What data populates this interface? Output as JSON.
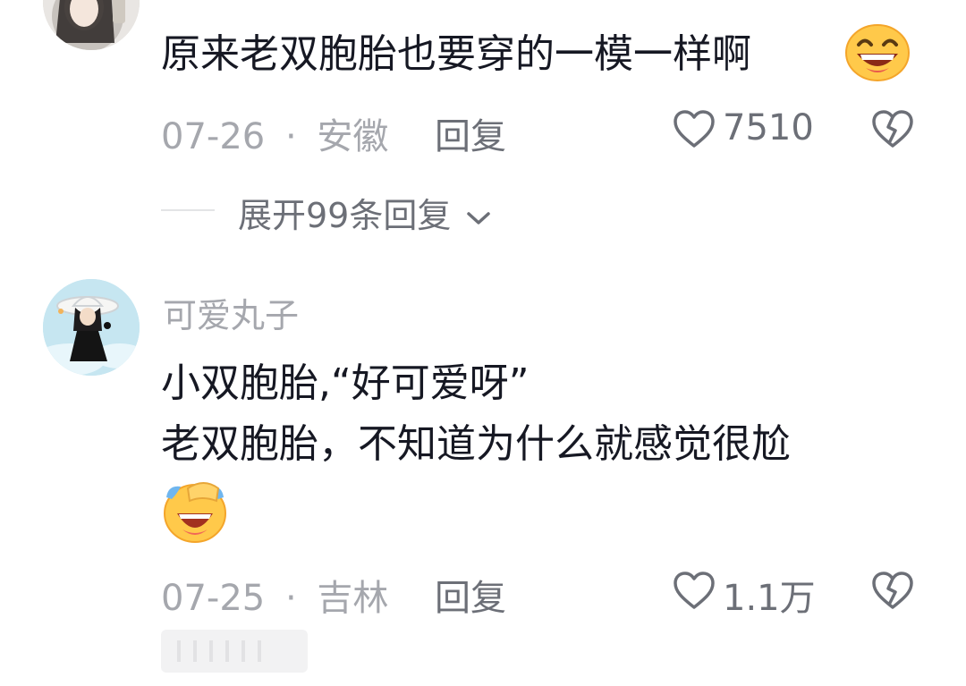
{
  "comments": [
    {
      "text": "原来老双胞胎也要穿的一模一样啊",
      "date": "07-26",
      "location": "安徽",
      "reply_label": "回复",
      "likes": "7510",
      "expand_label": "展开99条回复"
    },
    {
      "username": "可爱丸子",
      "text_line1": "小双胞胎,“好可爱呀”",
      "text_line2": "老双胞胎，不知道为什么就感觉很尬",
      "date": "07-25",
      "location": "吉林",
      "reply_label": "回复",
      "likes": "1.1万"
    }
  ],
  "meta_separator": "·",
  "colors": {
    "text_primary": "#161823",
    "text_secondary": "#a5a7ad",
    "icon": "#6c6f77"
  },
  "icons": [
    "heart-outline-icon",
    "broken-heart-icon",
    "chevron-down-icon",
    "grin-emoji-icon",
    "laughing-tears-emoji-icon"
  ]
}
